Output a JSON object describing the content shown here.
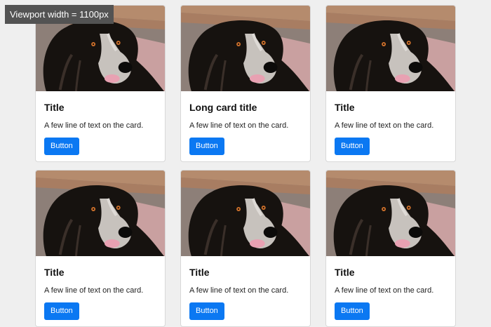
{
  "viewport_badge": "Viewport width = 1100px",
  "cards": [
    {
      "title": "Title",
      "text": "A few line of text on the card.",
      "button": "Button"
    },
    {
      "title": "Long card title",
      "text": "A few line of text on the card.",
      "button": "Button"
    },
    {
      "title": "Title",
      "text": "A few line of text on the card.",
      "button": "Button"
    },
    {
      "title": "Title",
      "text": "A few line of text on the card.",
      "button": "Button"
    },
    {
      "title": "Title",
      "text": "A few line of text on the card.",
      "button": "Button"
    },
    {
      "title": "Title",
      "text": "A few line of text on the card.",
      "button": "Button"
    }
  ],
  "colors": {
    "page_background": "#efefef",
    "badge_background": "#535353",
    "button_primary": "#0b78f2"
  }
}
